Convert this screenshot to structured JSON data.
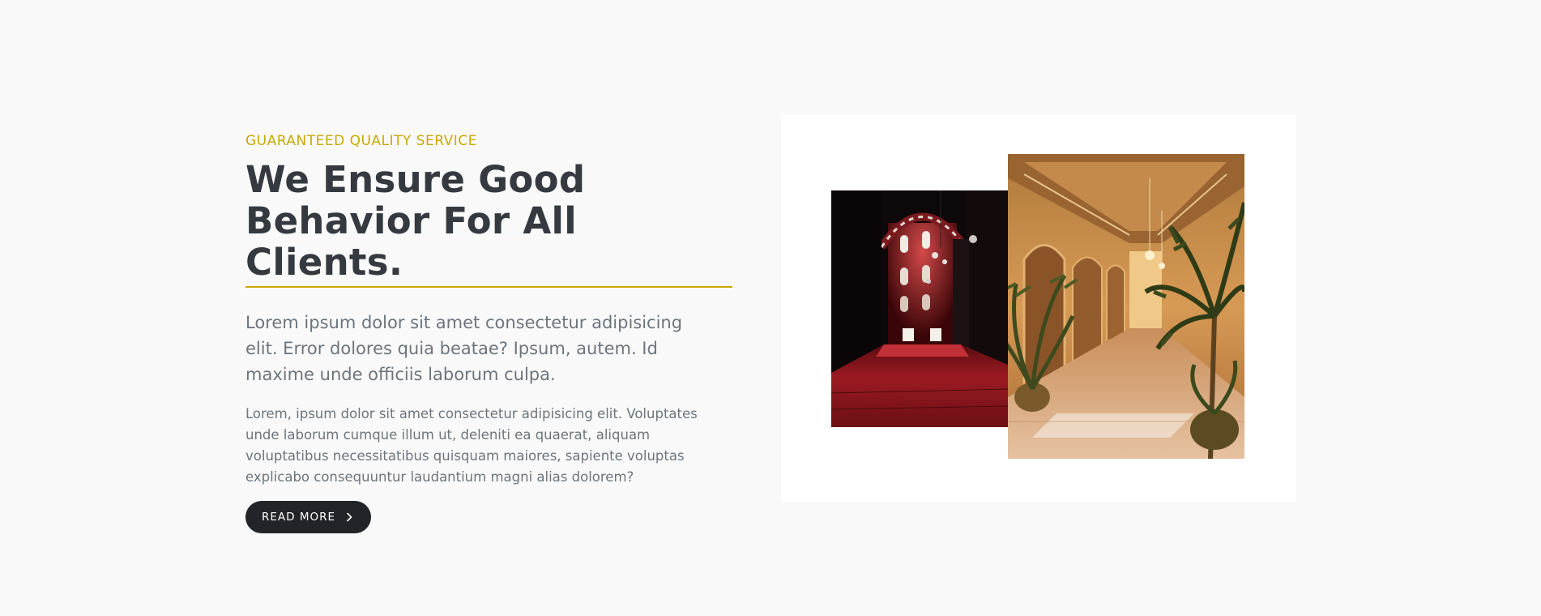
{
  "about": {
    "eyebrow": "GUARANTEED QUALITY SERVICE",
    "heading_line1": "We Ensure Good",
    "heading_line2": "Behavior For All Clients.",
    "lead": "Lorem ipsum dolor sit amet consectetur adipisicing elit. Error dolores quia beatae? Ipsum, autem. Id maxime unde officiis laborum culpa.",
    "body": "Lorem, ipsum dolor sit amet consectetur adipisicing elit. Voluptates unde laborum cumque illum ut, deleniti ea quaerat, aliquam voluptatibus necessitatibus quisquam maiores, sapiente voluptas explicabo consequuntur laudantium magni alias dolorem?",
    "button_label": "READ MORE",
    "button_icon": "chevron-right-icon"
  },
  "gallery": {
    "images": [
      "mosque-hall-image",
      "palace-corridor-image"
    ]
  },
  "colors": {
    "accent": "#c9a80a",
    "heading": "#343a40",
    "text": "#6c757d",
    "button_bg": "#212529",
    "page_bg": "#f9f9f9"
  }
}
